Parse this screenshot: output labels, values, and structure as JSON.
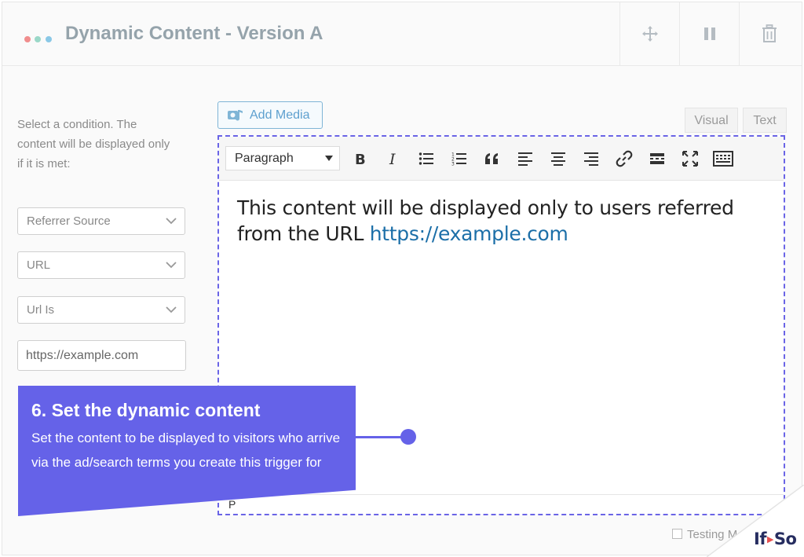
{
  "header": {
    "title": "Dynamic Content - Version A",
    "dot_colors": [
      "#f08d8d",
      "#9ad8c8",
      "#8ac8e6"
    ],
    "actions": [
      {
        "name": "move-icon"
      },
      {
        "name": "pause-icon"
      },
      {
        "name": "trash-icon"
      }
    ]
  },
  "condition": {
    "instructions": "Select a condition. The content will be displayed only if it is met:",
    "selects": [
      {
        "value": "Referrer Source"
      },
      {
        "value": "URL"
      },
      {
        "value": "Url Is"
      }
    ],
    "url_value": "https://example.com"
  },
  "editor": {
    "add_media_label": "Add Media",
    "tabs": {
      "visual": "Visual",
      "text": "Text"
    },
    "format_select": "Paragraph",
    "toolbar_icons": [
      "bold-icon",
      "italic-icon",
      "bullet-list-icon",
      "numbered-list-icon",
      "blockquote-icon",
      "align-left-icon",
      "align-center-icon",
      "align-right-icon",
      "link-icon",
      "read-more-icon",
      "fullscreen-icon",
      "toolbar-toggle-icon"
    ],
    "content_text": "This content will be displayed only to users referred from the URL ",
    "content_link": "https://example.com",
    "status_path": "P"
  },
  "callout": {
    "title": "6. Set the dynamic content",
    "body": "Set the content to be displayed to visitors who arrive via the ad/search terms you create this trigger for",
    "color": "#6562e8"
  },
  "footer": {
    "testing_label": "Testing M"
  },
  "logo": {
    "left": "If",
    "right": "So"
  }
}
